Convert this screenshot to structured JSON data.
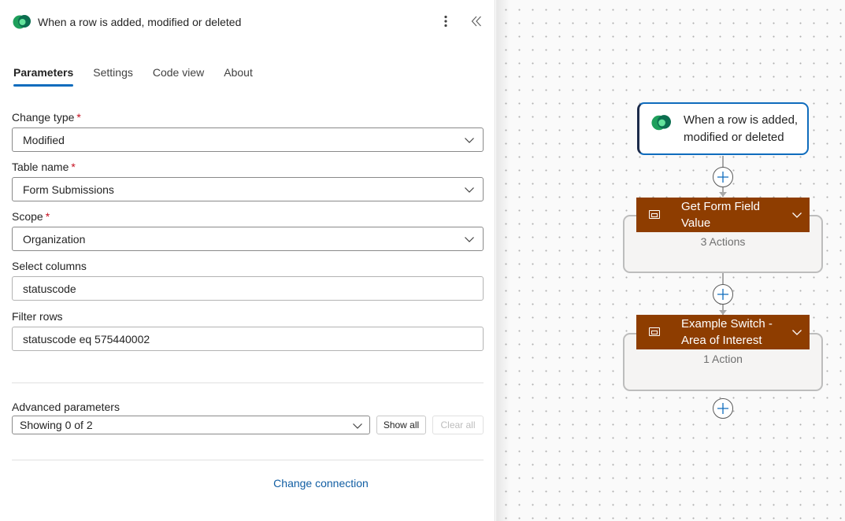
{
  "panel": {
    "title": "When a row is added, modified or deleted",
    "tabs": [
      "Parameters",
      "Settings",
      "Code view",
      "About"
    ],
    "active_tab": "Parameters",
    "fields": {
      "change_type": {
        "label": "Change type",
        "required_mark": "*",
        "value": "Modified"
      },
      "table_name": {
        "label": "Table name",
        "required_mark": "*",
        "value": "Form Submissions"
      },
      "scope": {
        "label": "Scope",
        "required_mark": "*",
        "value": "Organization"
      },
      "select_columns": {
        "label": "Select columns",
        "value": "statuscode"
      },
      "filter_rows": {
        "label": "Filter rows",
        "value": "statuscode eq 575440002"
      }
    },
    "advanced": {
      "label": "Advanced parameters",
      "value": "Showing 0 of 2",
      "show_all": "Show all",
      "clear_all": "Clear all"
    },
    "change_connection": "Change connection"
  },
  "canvas": {
    "trigger": {
      "title": "When a row is added, modified or deleted"
    },
    "scopes": [
      {
        "title": "Get Form Field Value",
        "count": "3 Actions",
        "header_color": "#8e3d00"
      },
      {
        "title": "Example Switch - Area of Interest",
        "count": "1 Action",
        "header_color": "#8e3d00"
      }
    ]
  },
  "colors": {
    "accent": "#0f6cbd",
    "link": "#115ea3",
    "required": "#c50f1f",
    "scope_header": "#8e3d00"
  },
  "icons": [
    "dataverse-logo-icon",
    "more-vertical-icon",
    "collapse-panel-icon",
    "chevron-down-icon",
    "add-icon",
    "scope-icon"
  ]
}
